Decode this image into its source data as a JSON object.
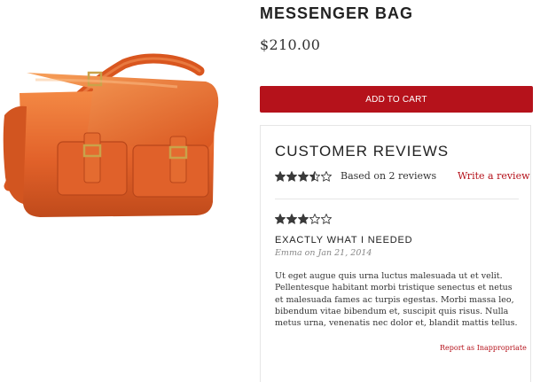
{
  "product": {
    "title": "MESSENGER BAG",
    "price": "$210.00",
    "add_to_cart_label": "ADD TO CART",
    "image_icon": "leather-messenger-bag-image"
  },
  "reviews": {
    "heading": "CUSTOMER REVIEWS",
    "average_rating": 3.5,
    "max_rating": 5,
    "summary_text": "Based on 2 reviews",
    "write_review_label": "Write a review",
    "items": [
      {
        "rating": 3,
        "title": "EXACTLY WHAT I NEEDED",
        "author": "Emma",
        "on_text": "on",
        "date": "Jan 21, 2014",
        "body": "Ut eget augue quis urna luctus malesuada ut et velit. Pellentesque habitant morbi tristique senectus et netus et malesuada fames ac turpis egestas. Morbi massa leo, bibendum vitae bibendum et, suscipit quis risus. Nulla metus urna, venenatis nec dolor et, blandit mattis tellus.",
        "report_label": "Report as Inappropriate"
      }
    ]
  },
  "colors": {
    "accent": "#b5121b",
    "star": "#3a3a3a",
    "bag_leather": "#e2622a"
  }
}
